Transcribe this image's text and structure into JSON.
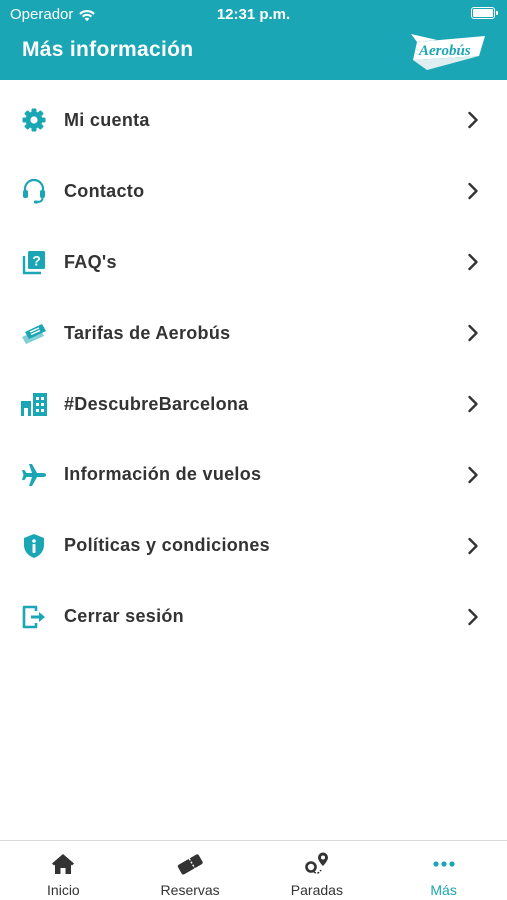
{
  "status_bar": {
    "carrier": "Operador",
    "time": "12:31 p.m."
  },
  "header": {
    "title": "Más información",
    "logo_text": "Aerobús"
  },
  "colors": {
    "brand": "#1aa6b4",
    "text": "#333333",
    "active_tab": "#1aa6b4"
  },
  "menu": {
    "items": [
      {
        "label": "Mi cuenta",
        "icon": "gear-icon"
      },
      {
        "label": "Contacto",
        "icon": "headset-icon"
      },
      {
        "label": "FAQ's",
        "icon": "question-cards-icon"
      },
      {
        "label": "Tarifas de Aerobús",
        "icon": "ticket-icon"
      },
      {
        "label": "#DescubreBarcelona",
        "icon": "buildings-icon"
      },
      {
        "label": "Información de vuelos",
        "icon": "airplane-icon"
      },
      {
        "label": "Políticas y condiciones",
        "icon": "shield-info-icon"
      },
      {
        "label": "Cerrar sesión",
        "icon": "logout-icon"
      }
    ]
  },
  "tabbar": {
    "tabs": [
      {
        "label": "Inicio",
        "icon": "home-icon",
        "active": false
      },
      {
        "label": "Reservas",
        "icon": "tickets-icon",
        "active": false
      },
      {
        "label": "Paradas",
        "icon": "route-pins-icon",
        "active": false
      },
      {
        "label": "Más",
        "icon": "more-dots-icon",
        "active": true
      }
    ]
  }
}
